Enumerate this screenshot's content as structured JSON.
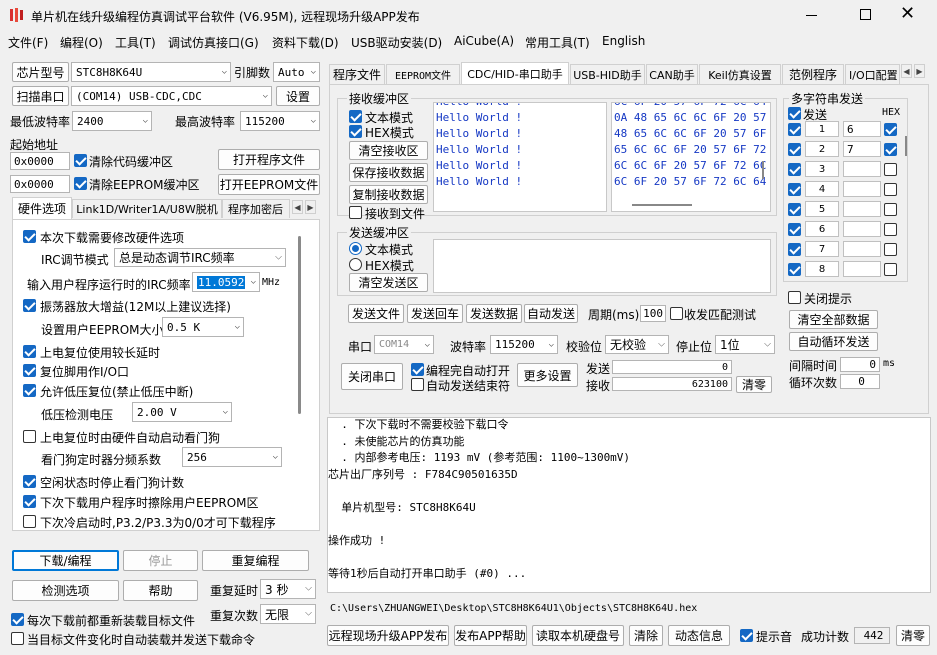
{
  "title": "单片机在线升级编程仿真调试平台软件 (V6.95M), 远程现场升级APP发布",
  "menu": [
    "文件(F)",
    "编程(O)",
    "工具(T)",
    "调试仿真接口(G)",
    "资料下载(D)",
    "USB驱动安装(D)",
    "AiCube(A)",
    "常用工具(T)",
    "English"
  ],
  "left": {
    "chip_label": "芯片型号",
    "chip_value": "STC8H8K64U",
    "pin_label": "引脚数",
    "pin_value": "Auto",
    "scan_button": "扫描串口",
    "port_value": "(COM14) USB-CDC,CDC",
    "settings_button": "设置",
    "min_baud_label": "最低波特率",
    "min_baud_value": "2400",
    "max_baud_label": "最高波特率",
    "max_baud_value": "115200",
    "start_addr_label": "起始地址",
    "addr1": "0x0000",
    "clear_code_label": "清除代码缓冲区",
    "open_prog_button": "打开程序文件",
    "addr2": "0x0000",
    "clear_eeprom_label": "清除EEPROM缓冲区",
    "open_eeprom_button": "打开EEPROM文件",
    "tabs": [
      "硬件选项",
      "Link1D/Writer1A/U8W脱机",
      "程序加密后"
    ],
    "hw": {
      "modify": "本次下载需要修改硬件选项",
      "irc_mode_label": "IRC调节模式",
      "irc_mode_value": "总是动态调节IRC频率",
      "irc_freq_label": "输入用户程序运行时的IRC频率",
      "irc_freq_value": "11.0592",
      "mhz": "MHz",
      "osc": "振荡器放大增益(12M以上建议选择)",
      "eeprom_size_label": "设置用户EEPROM大小",
      "eeprom_size_value": "0.5 K",
      "power_delay": "上电复位使用较长延时",
      "reset_io": "复位脚用作I/O口",
      "low_volt": "允许低压复位(禁止低压中断)",
      "low_volt_label": "低压检测电压",
      "low_volt_value": "2.00 V",
      "watchdog": "上电复位时由硬件自动启动看门狗",
      "wdt_div_label": "看门狗定时器分频系数",
      "wdt_div_value": "256",
      "idle_wdt": "空闲状态时停止看门狗计数",
      "erase_eeprom": "下次下载用户程序时擦除用户EEPROM区",
      "cold_boot": "下次冷启动时,P3.2/P3.3为0/0才可下载程序"
    },
    "download_button": "下载/编程",
    "stop_button": "停止",
    "reprog_button": "重复编程",
    "check_button": "检测选项",
    "help_button": "帮助",
    "repeat_delay_label": "重复延时",
    "repeat_delay_value": "3 秒",
    "repeat_count_label": "重复次数",
    "repeat_count_value": "无限",
    "reload_label": "每次下载前都重新装载目标文件",
    "auto_send_label": "当目标文件变化时自动装载并发送下载命令"
  },
  "right": {
    "tabs": [
      "程序文件",
      "EEPROM文件",
      "CDC/HID-串口助手",
      "USB-HID助手",
      "CAN助手",
      "Keil仿真设置",
      "范例程序",
      "I/O口配置"
    ],
    "recv_group": "接收缓冲区",
    "text_mode": "文本模式",
    "hex_mode": "HEX模式",
    "clear_recv": "清空接收区",
    "save_recv": "保存接收数据",
    "copy_recv": "复制接收数据",
    "recv_to_file": "接收到文件",
    "recv_text": [
      "Hello World !",
      "Hello World !",
      "Hello World !",
      "Hello World !",
      "Hello World !",
      "Hello World !"
    ],
    "recv_hex": [
      "6C 6F 20 57 6F 72 6C 64",
      "0A 48 65 6C 6C 6F 20 57",
      "48 65 6C 6C 6F 20 57 6F",
      "65 6C 6C 6F 20 57 6F 72",
      "6C 6C 6F 20 57 6F 72 6C",
      "6C 6F 20 57 6F 72 6C 64"
    ],
    "send_group": "发送缓冲区",
    "send_text_mode": "文本模式",
    "send_hex_mode": "HEX模式",
    "clear_send": "清空发送区",
    "send_file": "发送文件",
    "send_return": "发送回车",
    "send_data": "发送数据",
    "auto_send": "自动发送",
    "period_label": "周期(ms)",
    "period_value": "100",
    "match_label": "收发匹配测试",
    "multi_title": "多字符串发送",
    "send_col": "发送",
    "hex_col": "HEX",
    "rows": [
      {
        "n": "1",
        "v": "6",
        "hex": true
      },
      {
        "n": "2",
        "v": "7",
        "hex": true
      },
      {
        "n": "3",
        "v": "",
        "hex": false
      },
      {
        "n": "4",
        "v": "",
        "hex": false
      },
      {
        "n": "5",
        "v": "",
        "hex": false
      },
      {
        "n": "6",
        "v": "",
        "hex": false
      },
      {
        "n": "7",
        "v": "",
        "hex": false
      },
      {
        "n": "8",
        "v": "",
        "hex": false
      }
    ],
    "close_hint": "关闭提示",
    "clear_all": "清空全部数据",
    "auto_loop": "自动循环发送",
    "interval_label": "间隔时间",
    "interval_value": "0",
    "interval_unit": "ms",
    "loop_label": "循环次数",
    "loop_value": "0",
    "port_label": "串口",
    "port_value": "COM14",
    "baud_label": "波特率",
    "baud_value": "115200",
    "parity_label": "校验位",
    "parity_value": "无校验",
    "stop_label": "停止位",
    "stop_value": "1位",
    "close_port": "关闭串口",
    "auto_open": "编程完自动打开",
    "auto_end": "自动发送结束符",
    "more_settings": "更多设置",
    "send_label": "发送",
    "send_count": "0",
    "recv_label": "接收",
    "recv_count": "623100",
    "clear_count": "清零"
  },
  "log": [
    "  . 下次下载时不需要校验下载口令",
    "  . 未使能芯片的仿真功能",
    "  . 内部参考电压: 1193 mV (参考范围: 1100~1300mV)",
    "芯片出厂序列号 : F784C90501635D",
    "",
    "  单片机型号: STC8H8K64U",
    "",
    "操作成功 !",
    "",
    "等待1秒后自动打开串口助手 (#0) ..."
  ],
  "path": "C:\\Users\\ZHUANGWEI\\Desktop\\STC8H8K64U1\\Objects\\STC8H8K64U.hex",
  "bottom": {
    "publish": "远程现场升级APP发布",
    "publish_help": "发布APP帮助",
    "read_disk": "读取本机硬盘号",
    "clear": "清除",
    "anim": "动态信息",
    "beep": "提示音",
    "success_label": "成功计数",
    "success_value": "442",
    "zero": "清零"
  }
}
